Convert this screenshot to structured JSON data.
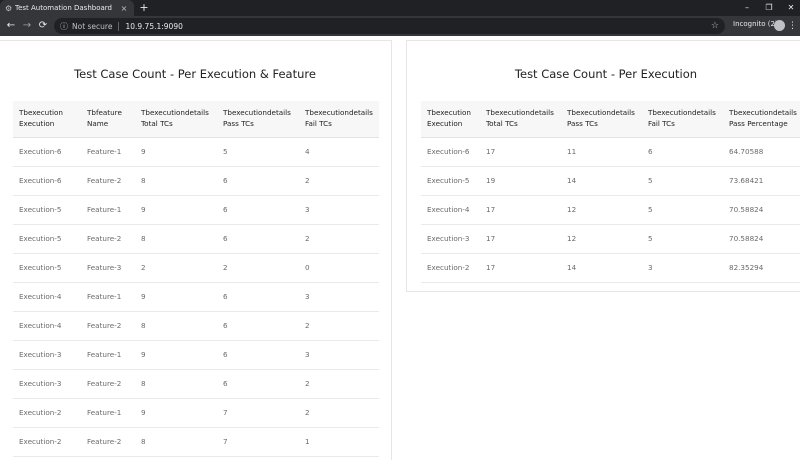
{
  "browser": {
    "tab_title": "Test Automation Dashboard",
    "tab_close": "×",
    "new_tab": "+",
    "not_secure": "Not secure",
    "url": "10.9.75.1:9090",
    "incognito_label": "Incognito (2)",
    "icons": {
      "favicon": "gear-icon",
      "back": "back-arrow-icon",
      "forward": "forward-arrow-icon",
      "reload": "reload-icon",
      "info": "info-icon",
      "star": "star-icon",
      "menu": "menu-icon"
    }
  },
  "left_card": {
    "title": "Test Case Count - Per Execution & Feature",
    "headers": [
      [
        "Tbexecution",
        "Execution"
      ],
      [
        "Tbfeature",
        "Name"
      ],
      [
        "Tbexecutiondetails",
        "Total TCs"
      ],
      [
        "Tbexecutiondetails",
        "Pass TCs"
      ],
      [
        "Tbexecutiondetails",
        "Fail TCs"
      ]
    ],
    "rows": [
      [
        "Execution-6",
        "Feature-1",
        "9",
        "5",
        "4"
      ],
      [
        "Execution-6",
        "Feature-2",
        "8",
        "6",
        "2"
      ],
      [
        "Execution-5",
        "Feature-1",
        "9",
        "6",
        "3"
      ],
      [
        "Execution-5",
        "Feature-2",
        "8",
        "6",
        "2"
      ],
      [
        "Execution-5",
        "Feature-3",
        "2",
        "2",
        "0"
      ],
      [
        "Execution-4",
        "Feature-1",
        "9",
        "6",
        "3"
      ],
      [
        "Execution-4",
        "Feature-2",
        "8",
        "6",
        "2"
      ],
      [
        "Execution-3",
        "Feature-1",
        "9",
        "6",
        "3"
      ],
      [
        "Execution-3",
        "Feature-2",
        "8",
        "6",
        "2"
      ],
      [
        "Execution-2",
        "Feature-1",
        "9",
        "7",
        "2"
      ],
      [
        "Execution-2",
        "Feature-2",
        "8",
        "7",
        "1"
      ]
    ]
  },
  "right_card": {
    "title": "Test Case Count - Per Execution",
    "headers": [
      [
        "Tbexecution",
        "Execution"
      ],
      [
        "Tbexecutiondetails",
        "Total TCs"
      ],
      [
        "Tbexecutiondetails",
        "Pass TCs"
      ],
      [
        "Tbexecutiondetails",
        "Fail TCs"
      ],
      [
        "Tbexecutiondetails",
        "Pass Percentage"
      ]
    ],
    "rows": [
      [
        "Execution-6",
        "17",
        "11",
        "6",
        "64.70588"
      ],
      [
        "Execution-5",
        "19",
        "14",
        "5",
        "73.68421"
      ],
      [
        "Execution-4",
        "17",
        "12",
        "5",
        "70.58824"
      ],
      [
        "Execution-3",
        "17",
        "12",
        "5",
        "70.58824"
      ],
      [
        "Execution-2",
        "17",
        "14",
        "3",
        "82.35294"
      ]
    ]
  }
}
